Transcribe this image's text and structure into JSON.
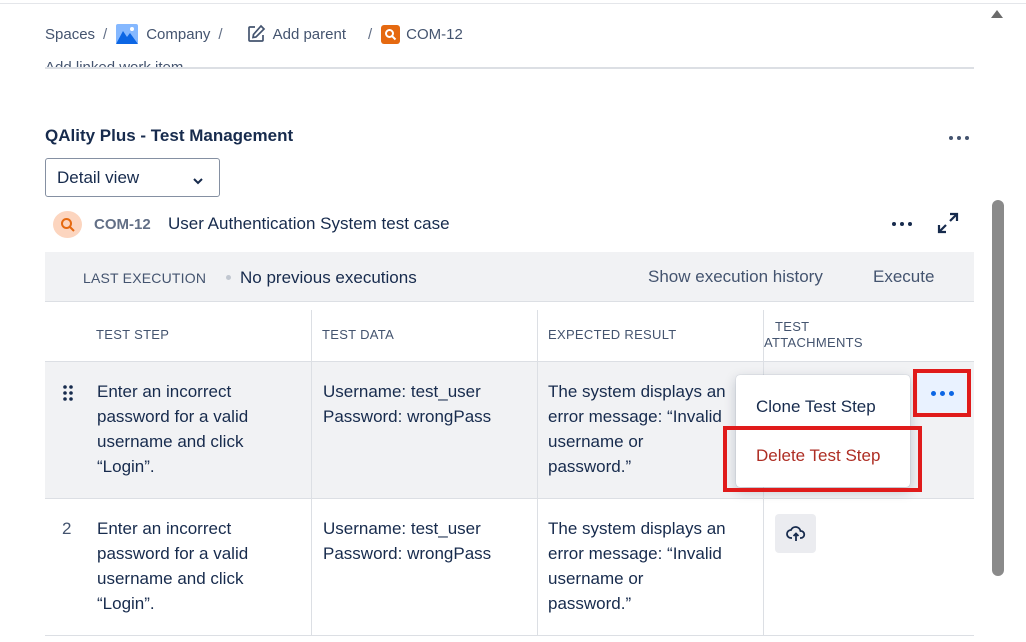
{
  "breadcrumb": {
    "spaces": "Spaces",
    "sep": "/",
    "company": "Company",
    "add_parent": "Add parent",
    "current_key": "COM-12"
  },
  "cut_off_text": "Add linked work item",
  "section": {
    "title": "QAlity Plus - Test Management",
    "view_select": "Detail view"
  },
  "test_case": {
    "key": "COM-12",
    "name": "User Authentication System test case"
  },
  "execution": {
    "label": "LAST EXECUTION",
    "value": "No previous executions",
    "history_link": "Show execution history",
    "execute_link": "Execute"
  },
  "table": {
    "headers": [
      "TEST STEP",
      "TEST DATA",
      "EXPECTED RESULT",
      "TEST",
      "ATTACHMENTS"
    ],
    "rows": [
      {
        "number": "",
        "step": [
          "Enter an incorrect",
          "password for a valid",
          "username and click",
          "“Login”."
        ],
        "data": [
          "Username: test_user",
          "Password: wrongPass"
        ],
        "expected": [
          "The system displays an",
          "error message: “Invalid",
          "username or",
          "password.”"
        ]
      },
      {
        "number": "2",
        "step": [
          "Enter an incorrect",
          "password for a valid",
          "username and click",
          "“Login”."
        ],
        "data": [
          "Username: test_user",
          "Password: wrongPass"
        ],
        "expected": [
          "The system displays an",
          "error message: “Invalid",
          "username or",
          "password.”"
        ]
      }
    ]
  },
  "menu": {
    "clone": "Clone Test Step",
    "delete": "Delete Test Step"
  },
  "colors": {
    "highlight": "#e01b1b",
    "delete_text": "#ae2e24",
    "accent": "#0c66e4",
    "row_selected_bg": "#f1f2f4"
  }
}
